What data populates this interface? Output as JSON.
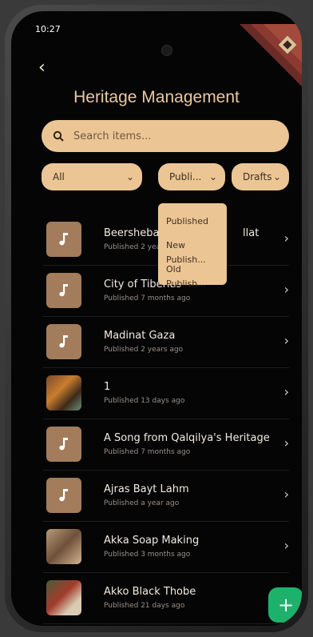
{
  "status": {
    "time": "10:27",
    "battery": "▮"
  },
  "header": {
    "back_label": "‹",
    "title": "Heritage Management"
  },
  "search": {
    "placeholder": "Search items..."
  },
  "filters": {
    "category": "All",
    "status": "Publi...",
    "type": "Drafts"
  },
  "status_menu": {
    "options": [
      "Published",
      "New Publish...",
      "Old Publish..."
    ]
  },
  "items": [
    {
      "title": "Beersheba",
      "title_suffix": "llat",
      "subtitle": "Published 2 yea"
    },
    {
      "title": "City of Tiberias",
      "subtitle": "Published 7 months ago"
    },
    {
      "title": "Madinat Gaza",
      "subtitle": "Published 2 years ago"
    },
    {
      "title": "1",
      "subtitle": "Published 13 days ago"
    },
    {
      "title": "A Song from Qalqilya's Heritage",
      "subtitle": "Published 7 months ago"
    },
    {
      "title": "Ajras Bayt Lahm",
      "subtitle": "Published a year ago"
    },
    {
      "title": "Akka Soap Making",
      "subtitle": "Published 3 months ago"
    },
    {
      "title": "Akko Black Thobe",
      "subtitle": "Published 21 days ago"
    }
  ],
  "colors": {
    "accent": "#ecc595",
    "fab": "#1eb16b",
    "title": "#e8c9a3"
  },
  "fab": {
    "label": "+"
  }
}
